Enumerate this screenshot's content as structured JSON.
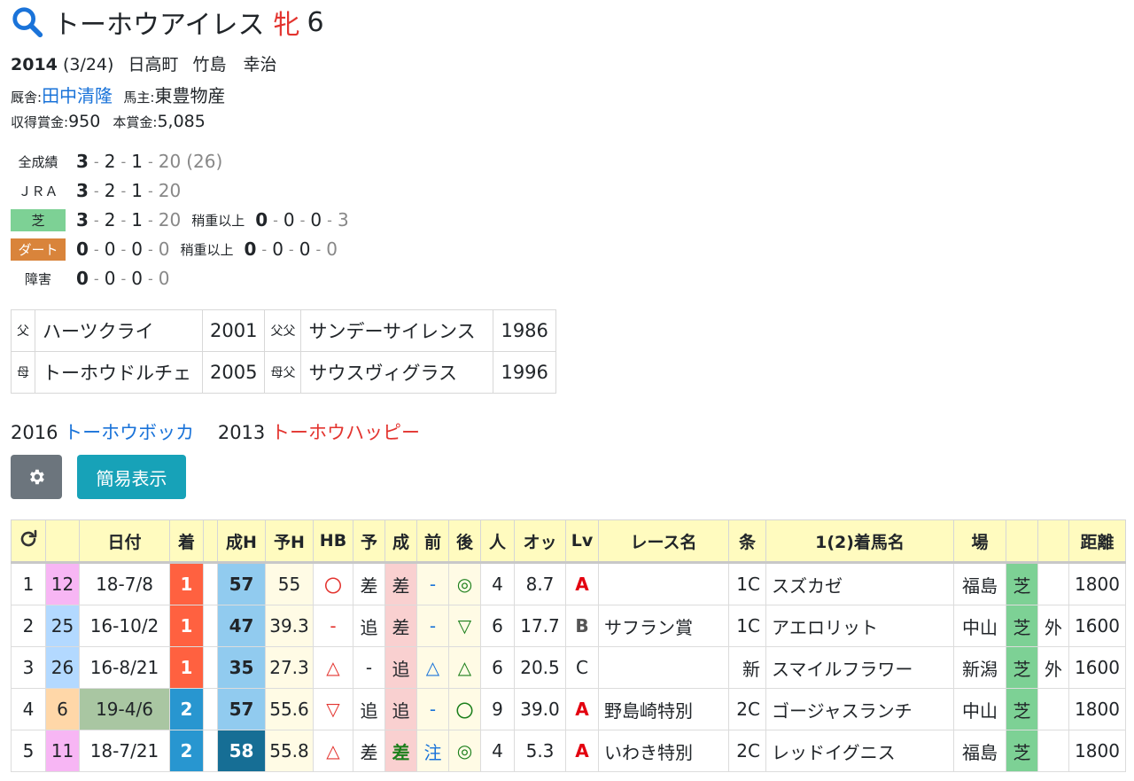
{
  "header": {
    "name": "トーホウアイレス",
    "sex": "牝",
    "age": "6"
  },
  "birth": {
    "year": "2014",
    "date": "(3/24)",
    "place": "日高町",
    "breeder": "竹島　幸治"
  },
  "stable": {
    "trainer_label": "厩舎:",
    "trainer": "田中清隆",
    "owner_label": "馬主:",
    "owner": "東豊物産"
  },
  "prize": {
    "earned_label": "収得賞金:",
    "earned": "950",
    "main_label": "本賞金:",
    "main": "5,085"
  },
  "records": {
    "all": {
      "label": "全成績",
      "w1": "3",
      "w2": "2",
      "w3": "1",
      "other": "20",
      "total": "(26)"
    },
    "jra": {
      "label": "ＪＲＡ",
      "w1": "3",
      "w2": "2",
      "w3": "1",
      "other": "20"
    },
    "turf": {
      "label": "芝",
      "w1": "3",
      "w2": "2",
      "w3": "1",
      "other": "20",
      "sub_label": "稍重以上",
      "s1": "0",
      "s2": "0",
      "s3": "0",
      "s4": "3"
    },
    "dirt": {
      "label": "ダート",
      "w1": "0",
      "w2": "0",
      "w3": "0",
      "other": "0",
      "sub_label": "稍重以上",
      "s1": "0",
      "s2": "0",
      "s3": "0",
      "s4": "0"
    },
    "jump": {
      "label": "障害",
      "w1": "0",
      "w2": "0",
      "w3": "0",
      "other": "0"
    }
  },
  "pedigree": {
    "sire_label": "父",
    "sire": "ハーツクライ",
    "sire_year": "2001",
    "sire_sire_label": "父父",
    "sire_sire": "サンデーサイレンス",
    "sire_sire_year": "1986",
    "dam_label": "母",
    "dam": "トーホウドルチェ",
    "dam_year": "2005",
    "dam_sire_label": "母父",
    "dam_sire": "サウスヴィグラス",
    "dam_sire_year": "1996"
  },
  "siblings": [
    {
      "year": "2016",
      "name": "トーホウボッカ",
      "color": "#1a73d9"
    },
    {
      "year": "2013",
      "name": "トーホウハッピー",
      "color": "#e3342f"
    }
  ],
  "buttons": {
    "settings_icon": "gear-icon",
    "simple_view": "簡易表示"
  },
  "table": {
    "headers": [
      "",
      "",
      "日付",
      "着",
      "",
      "成H",
      "予H",
      "HB",
      "予",
      "成",
      "前",
      "後",
      "人",
      "オッ",
      "Lv",
      "レース名",
      "条",
      "1(2)着馬名",
      "場",
      "",
      "",
      "距離"
    ],
    "refresh_icon": "refresh-icon",
    "rows": [
      {
        "n": "1",
        "days": "12",
        "date": "18-7/8",
        "pos": "1",
        "h": "57",
        "ph": "55",
        "hb": "〇",
        "y": "差",
        "s": "差",
        "f": "-",
        "b": "◎",
        "pop": "4",
        "odds": "8.7",
        "lv": "A",
        "race": "",
        "cls": "1C",
        "horse": "スズカゼ",
        "place": "福島",
        "surf": "芝",
        "io": "",
        "dist": "1800"
      },
      {
        "n": "2",
        "days": "25",
        "date": "16-10/2",
        "pos": "1",
        "h": "47",
        "ph": "39.3",
        "hb": "-",
        "y": "追",
        "s": "差",
        "f": "-",
        "b": "▽",
        "pop": "6",
        "odds": "17.7",
        "lv": "B",
        "race": "サフラン賞",
        "cls": "1C",
        "horse": "アエロリット",
        "place": "中山",
        "surf": "芝",
        "io": "外",
        "dist": "1600"
      },
      {
        "n": "3",
        "days": "26",
        "date": "16-8/21",
        "pos": "1",
        "h": "35",
        "ph": "27.3",
        "hb": "△",
        "y": "-",
        "s": "追",
        "f": "△",
        "b": "△",
        "pop": "6",
        "odds": "20.5",
        "lv": "C",
        "race": "",
        "cls": "新",
        "horse": "スマイルフラワー",
        "place": "新潟",
        "surf": "芝",
        "io": "外",
        "dist": "1600"
      },
      {
        "n": "4",
        "days": "6",
        "date": "19-4/6",
        "pos": "2",
        "h": "57",
        "ph": "55.6",
        "hb": "▽",
        "y": "追",
        "s": "追",
        "f": "-",
        "b": "〇",
        "pop": "9",
        "odds": "39.0",
        "lv": "A",
        "race": "野島崎特別",
        "cls": "2C",
        "horse": "ゴージャスランチ",
        "place": "中山",
        "surf": "芝",
        "io": "",
        "dist": "1800"
      },
      {
        "n": "5",
        "days": "11",
        "date": "18-7/21",
        "pos": "2",
        "h": "58",
        "ph": "55.8",
        "hb": "△",
        "y": "差",
        "s": "差",
        "f": "注",
        "b": "◎",
        "pop": "4",
        "odds": "5.3",
        "lv": "A",
        "race": "いわき特別",
        "cls": "2C",
        "horse": "レッドイグニス",
        "place": "福島",
        "surf": "芝",
        "io": "",
        "dist": "1800"
      }
    ]
  }
}
